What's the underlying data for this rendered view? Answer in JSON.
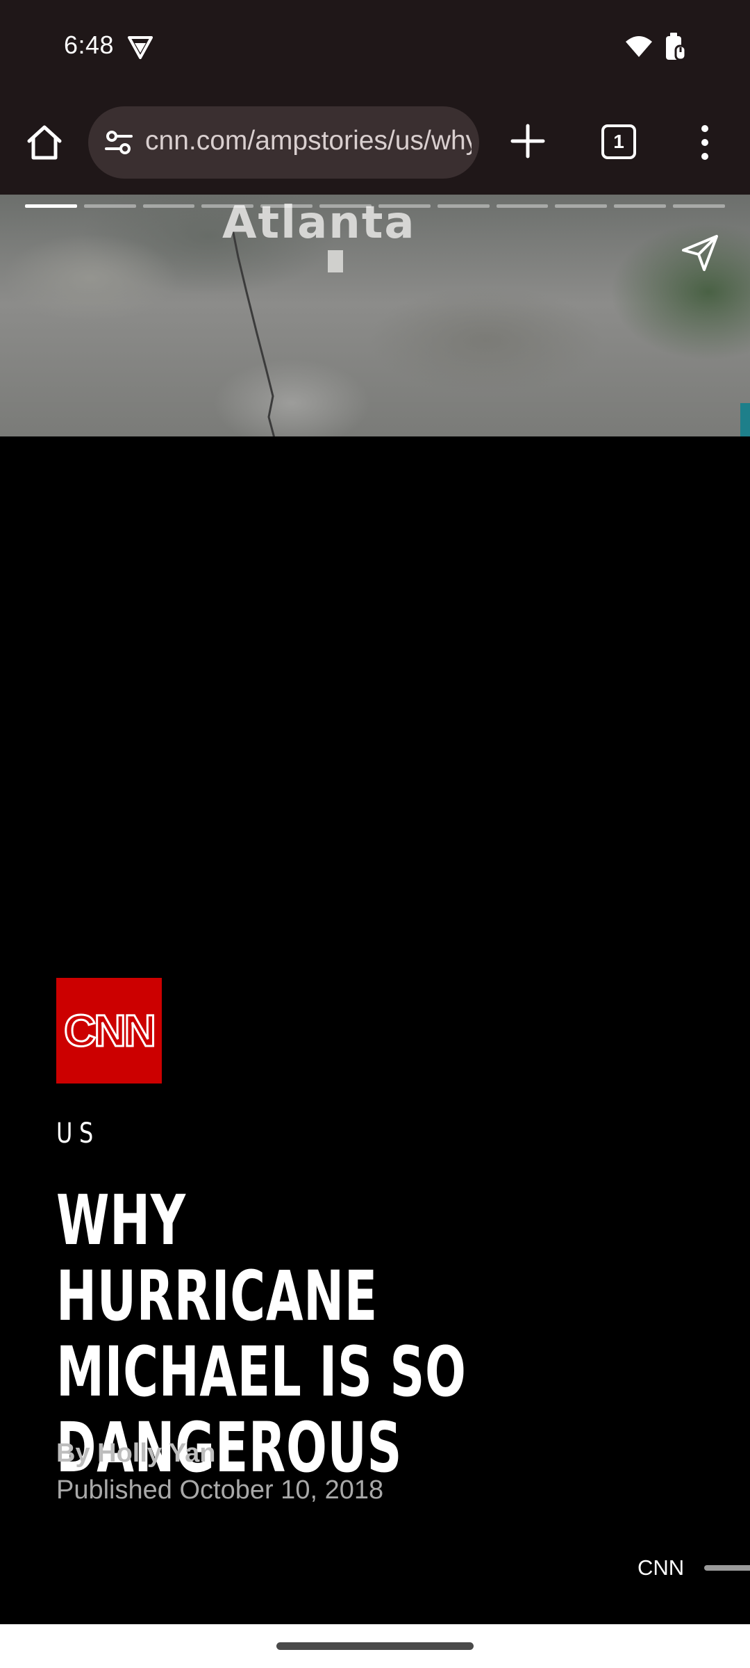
{
  "status_bar": {
    "time": "6:48",
    "icons": [
      "vpn-key-icon",
      "wifi-icon",
      "battery-icon"
    ]
  },
  "browser": {
    "url": "cnn.com/ampstories/us/why-hurricane-michael-is-so-dangerous",
    "tab_count": "1",
    "icons": [
      "home-icon",
      "tune-icon",
      "plus-icon",
      "more-vert-icon"
    ]
  },
  "story": {
    "hero_image": {
      "description_label": "Atlanta"
    },
    "progress": {
      "total_pages": 12,
      "current_page": 1
    },
    "logo_text": "CNN",
    "section": "US",
    "headline": "WHY HURRICANE MICHAEL IS SO DANGEROUS",
    "byline": "By Holly Yan",
    "published": "Published October 10, 2018",
    "publisher": "CNN",
    "icons": [
      "share-icon"
    ]
  },
  "colors": {
    "chrome_background": "#1f1718",
    "url_pill": "#3a2f30",
    "brand_red": "#cc0000",
    "story_background": "#000000"
  }
}
